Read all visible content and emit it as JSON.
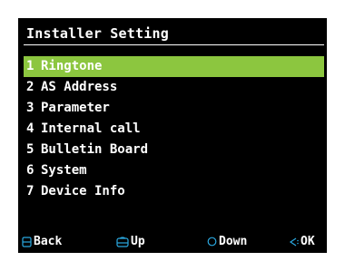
{
  "screen": {
    "title": "Installer Setting"
  },
  "menu": {
    "selected_index": 0,
    "items": [
      {
        "number": "1",
        "label": "Ringtone"
      },
      {
        "number": "2",
        "label": "AS Address"
      },
      {
        "number": "3",
        "label": "Parameter"
      },
      {
        "number": "4",
        "label": "Internal call"
      },
      {
        "number": "5",
        "label": "Bulletin Board"
      },
      {
        "number": "6",
        "label": "System"
      },
      {
        "number": "7",
        "label": "Device Info"
      }
    ]
  },
  "softkeys": {
    "back": {
      "label": "Back",
      "icon": "square-key-icon"
    },
    "up": {
      "label": "Up",
      "icon": "phone-key-icon"
    },
    "down": {
      "label": "Down",
      "icon": "circle-key-icon"
    },
    "ok": {
      "label": "OK",
      "icon": "speaker-key-icon"
    }
  },
  "colors": {
    "background": "#000000",
    "highlight": "#8cc63f",
    "text": "#ffffff",
    "key_icon": "#2aa8e0"
  }
}
